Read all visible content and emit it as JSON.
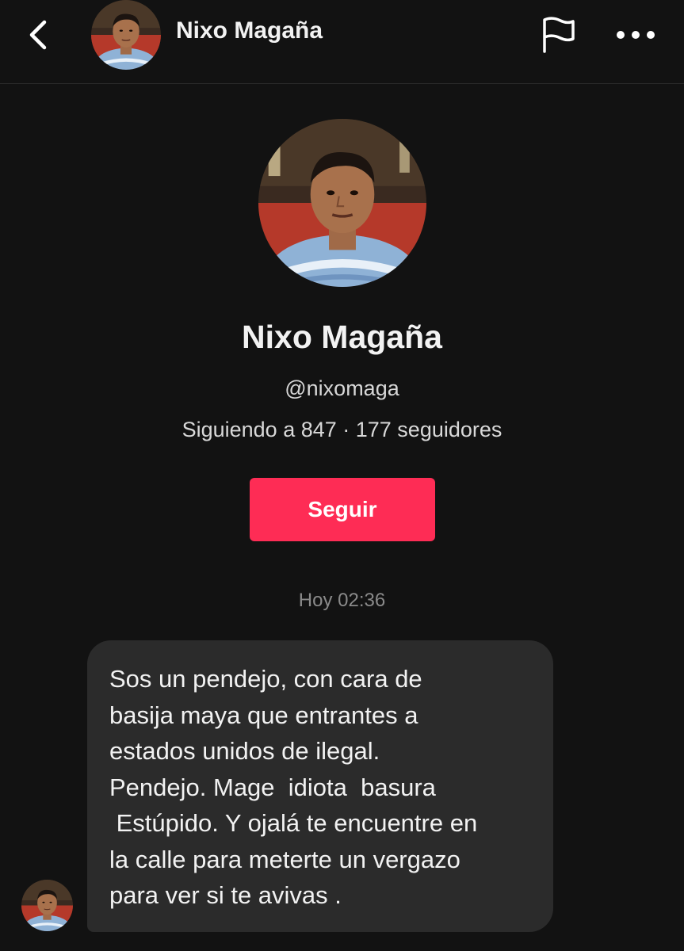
{
  "header": {
    "back_icon": "chevron-left-icon",
    "title": "Nixo Magaña",
    "flag_icon": "flag-icon",
    "more_icon": "more-horizontal-icon"
  },
  "profile": {
    "name": "Nixo Magaña",
    "handle": "@nixomaga",
    "stats": "Siguiendo a 847 · 177 seguidores",
    "follow_label": "Seguir"
  },
  "conversation": {
    "timestamp": "Hoy 02:36",
    "messages": [
      {
        "text": "Sos un pendejo, con cara de\nbasija maya que entrantes a\nestados unidos de ilegal.\nPendejo. Mage  idiota  basura\n Estúpido. Y ojalá te encuentre en\nla calle para meterte un vergazo\npara ver si te avivas ."
      }
    ]
  },
  "colors": {
    "background": "#121212",
    "accent": "#fe2c55",
    "bubble": "#2b2b2b",
    "muted_text": "#8a8a8a"
  }
}
